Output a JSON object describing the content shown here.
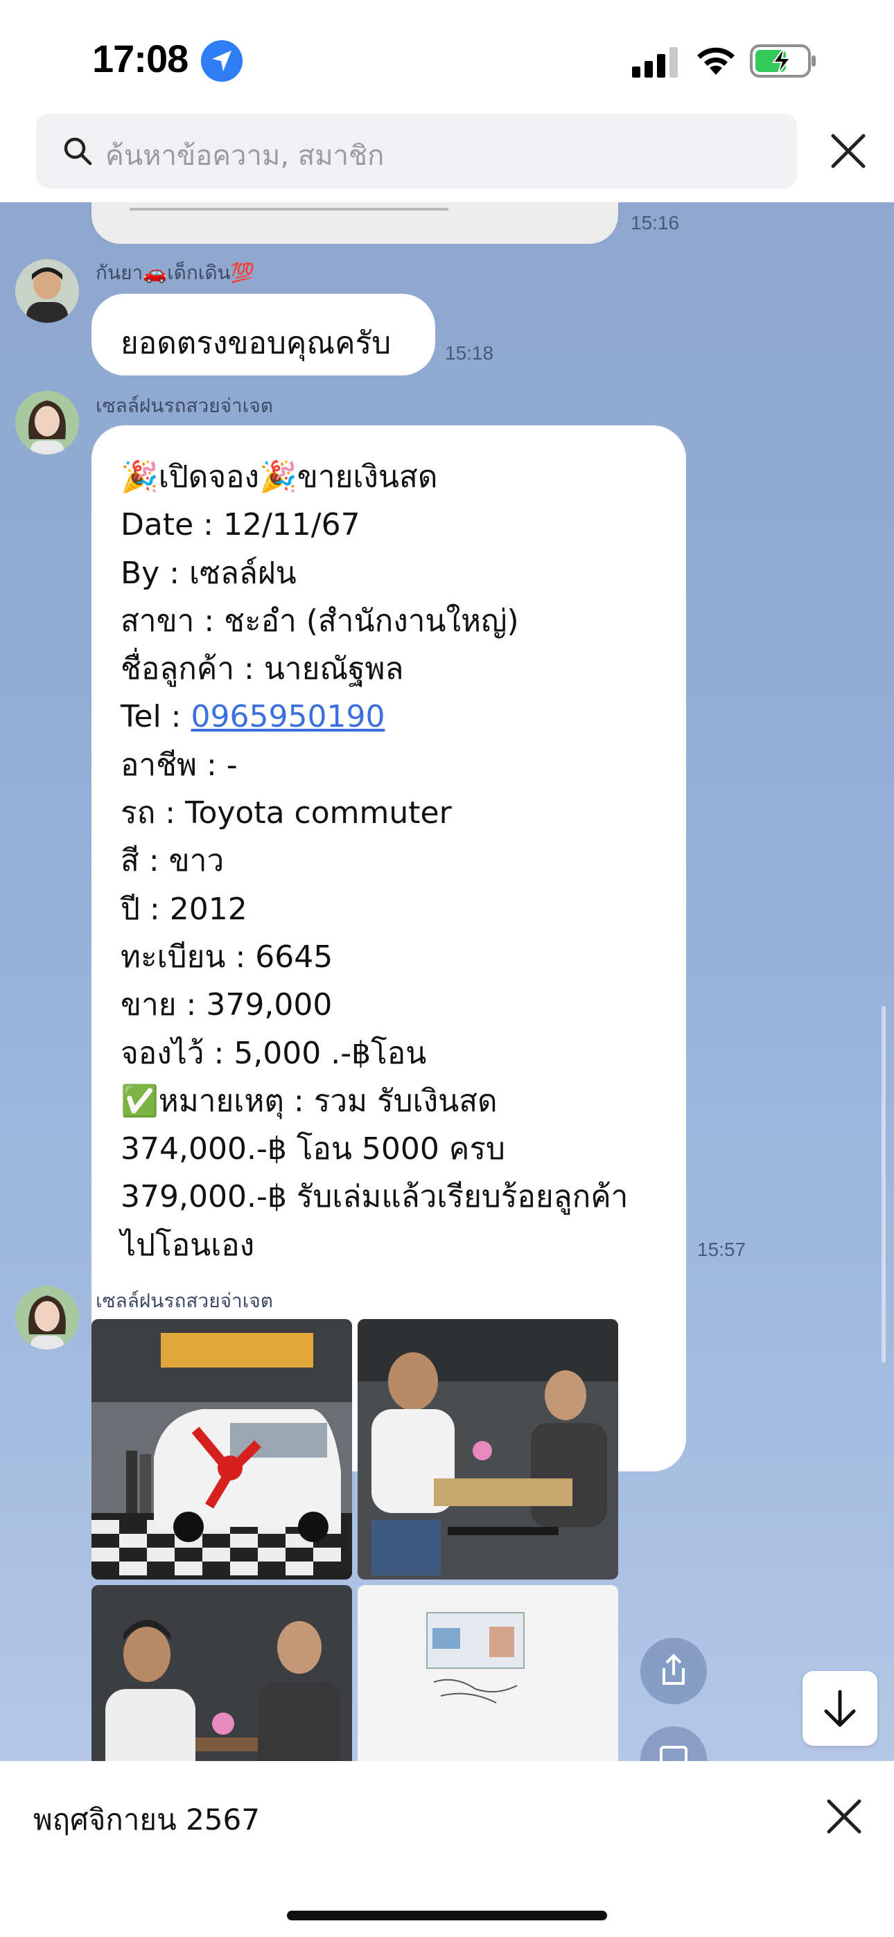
{
  "status_bar": {
    "time": "17:08"
  },
  "search": {
    "placeholder": "ค้นหาข้อความ, สมาชิก"
  },
  "chat": {
    "prev_image_time": "15:16",
    "messages": [
      {
        "sender": "กันยา🚗เด็กเดิน💯",
        "text": "ยอดตรงขอบคุณครับ",
        "time": "15:18"
      },
      {
        "sender": "เซลล์ฝนรถสวยจ่าเจต",
        "lines": {
          "l1": "🎉เปิดจอง🎉ขายเงินสด",
          "l2": "Date : 12/11/67",
          "l3": "By : เซลล์ฝน",
          "l4": "สาขา : ชะอำ (สำนักงานใหญ่)",
          "l5": "ชื่อลูกค้า : นายณัฐพล",
          "l6_label": "Tel : ",
          "l6_phone": "0965950190",
          "l7": "อาชีพ : -",
          "l8": "รถ : Toyota commuter",
          "l9": "สี : ขาว",
          "l10": "ปี : 2012",
          "l11": "ทะเบียน : 6645",
          "l12": "ขาย : 379,000",
          "l13": "จองไว้ : 5,000 .-฿โอน",
          "l14": "✅หมายเหตุ : รวม รับเงินสด",
          "l15": "374,000.-฿ โอน 5000 ครบ",
          "l16": "379,000.-฿ รับเล่มแล้วเรียบร้อยลูกค้า",
          "l17": "ไปโอนเอง"
        },
        "time": "15:57"
      },
      {
        "sender": "เซลล์ฝนรถสวยจ่าเจต",
        "photo_count": 4
      }
    ]
  },
  "bottom_bar": {
    "month_label": "พฤศจิกายน 2567"
  },
  "colors": {
    "chat_bg": "#93aed8",
    "link": "#3a6fe0",
    "location_badge": "#2f7df6",
    "battery_green": "#34c759"
  },
  "icons": [
    "location-arrow-icon",
    "signal-icon",
    "wifi-icon",
    "battery-charging-icon",
    "search-icon",
    "close-icon",
    "share-icon",
    "arrow-down-icon"
  ]
}
